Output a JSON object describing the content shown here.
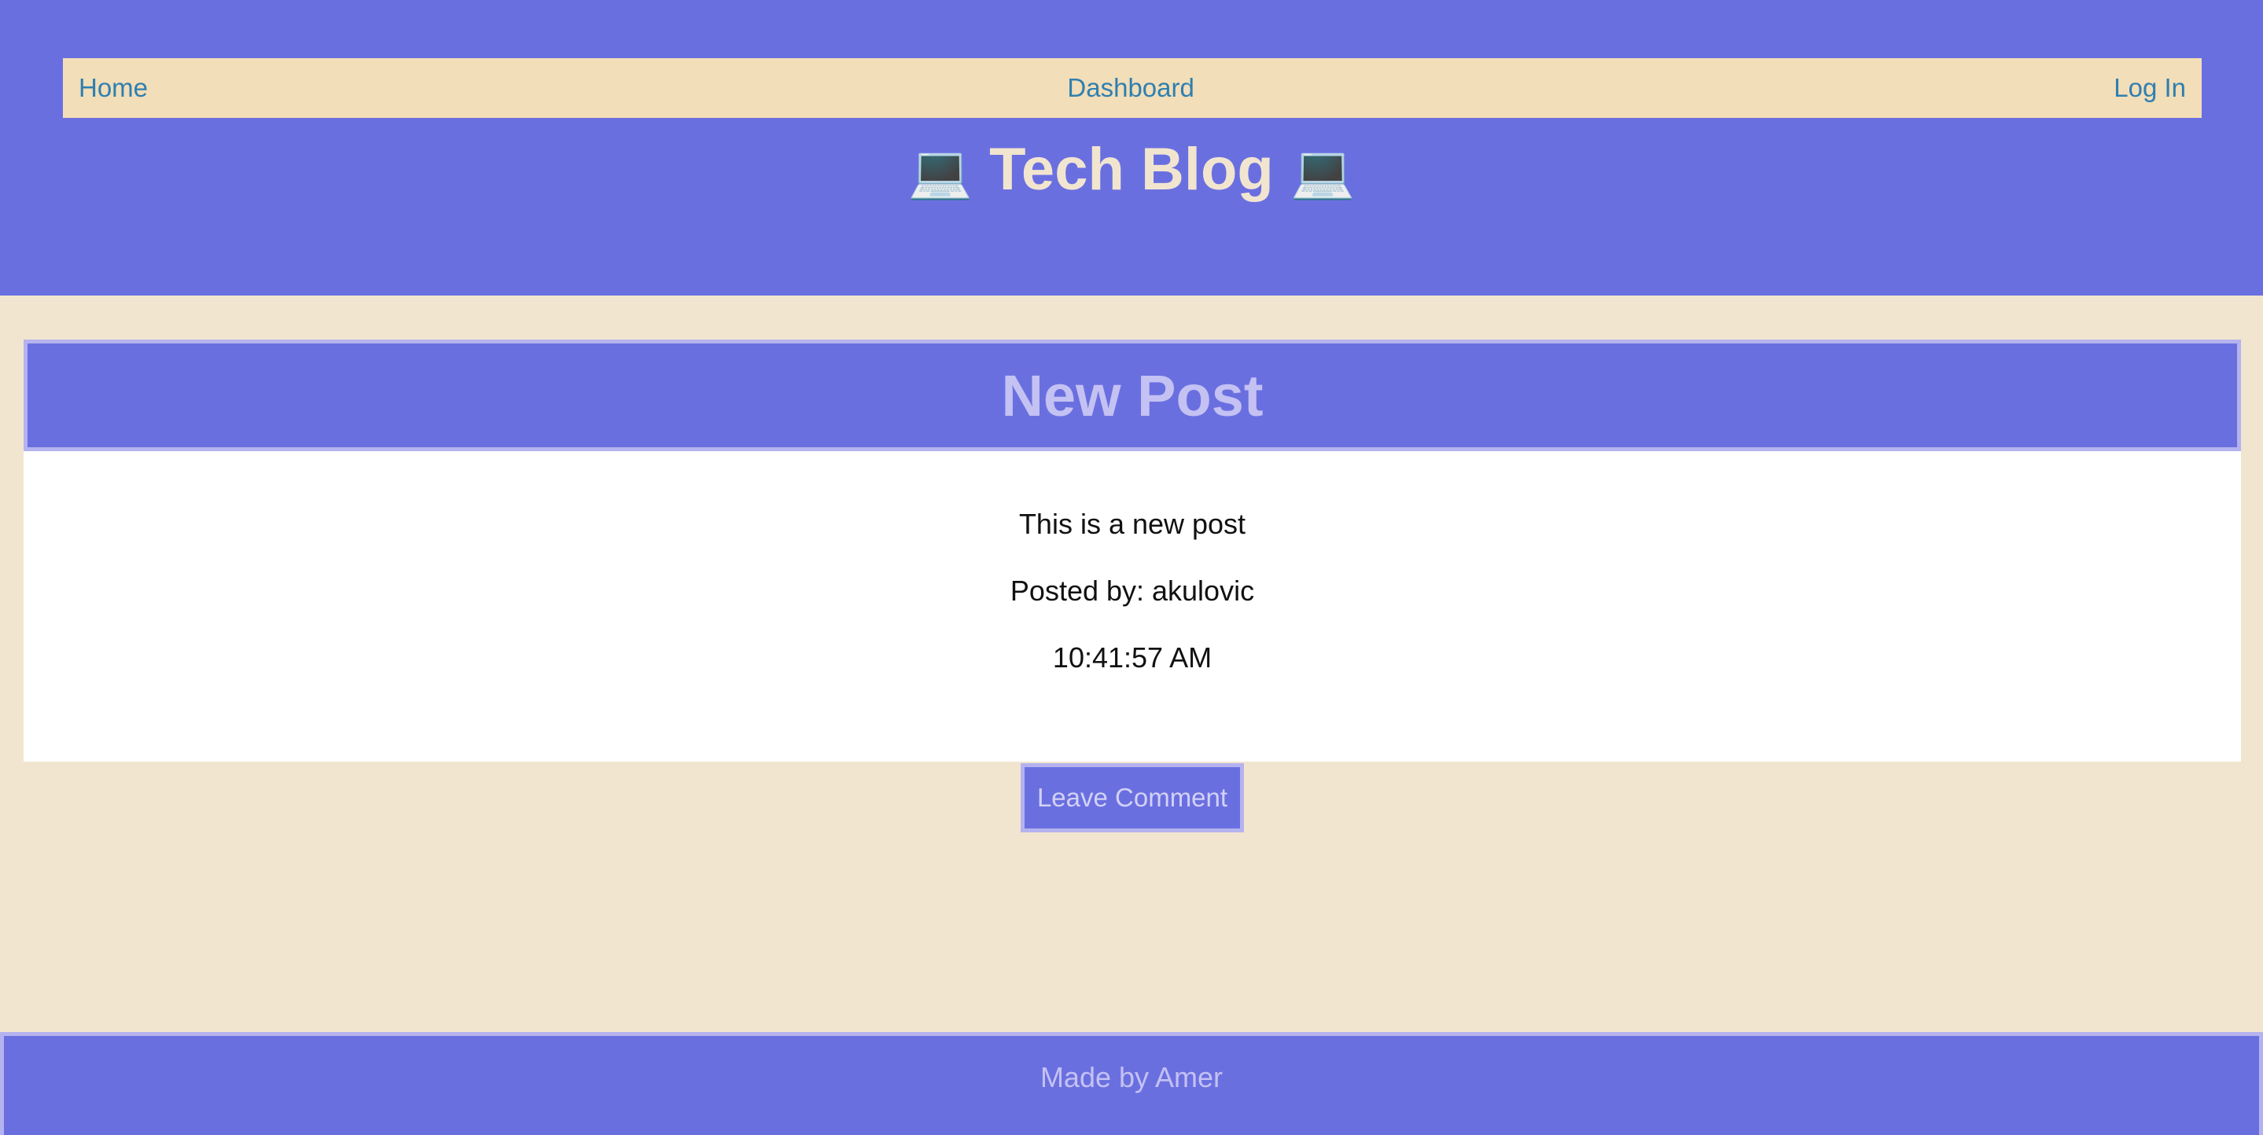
{
  "nav": {
    "home": "Home",
    "dashboard": "Dashboard",
    "login": "Log In"
  },
  "site": {
    "emoji": "💻",
    "title": "Tech Blog"
  },
  "post": {
    "title": "New Post",
    "content": "This is a new post",
    "posted_by": "Posted by: akulovic",
    "time": "10:41:57 AM"
  },
  "actions": {
    "leave_comment": "Leave Comment"
  },
  "footer": {
    "text": "Made by Amer"
  },
  "colors": {
    "primary": "#6a6fe0",
    "cream": "#f1e5d0",
    "nav_bg": "#f2deb8",
    "link": "#2f7fb0",
    "border": "#b5b3ef"
  }
}
